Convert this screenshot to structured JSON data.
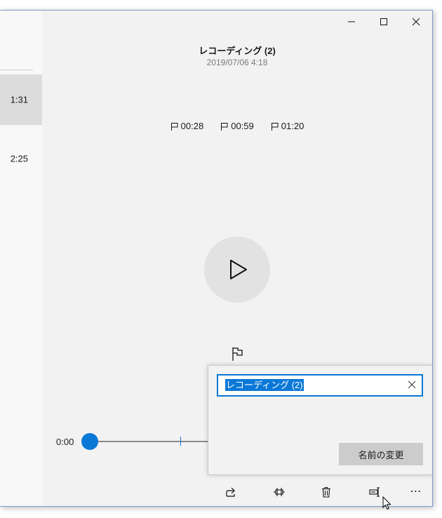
{
  "sidebar": {
    "items": [
      {
        "duration": "1:31",
        "selected": true
      },
      {
        "duration": "2:25",
        "selected": false
      }
    ]
  },
  "window_controls": {
    "minimize": "minimize-icon",
    "maximize": "maximize-icon",
    "close": "close-icon"
  },
  "recording": {
    "title": "レコーディング (2)",
    "date": "2019/07/06 4:18",
    "markers": [
      "00:28",
      "00:59",
      "01:20"
    ]
  },
  "player": {
    "time_start": "0:00",
    "accent": "#0a78d7"
  },
  "rename": {
    "input_value": "レコーディング (2)",
    "button_label": "名前の変更"
  },
  "toolbar": {
    "share": "share-icon",
    "trim": "trim-icon",
    "delete": "trash-icon",
    "rename": "rename-icon",
    "more": "⋯"
  }
}
